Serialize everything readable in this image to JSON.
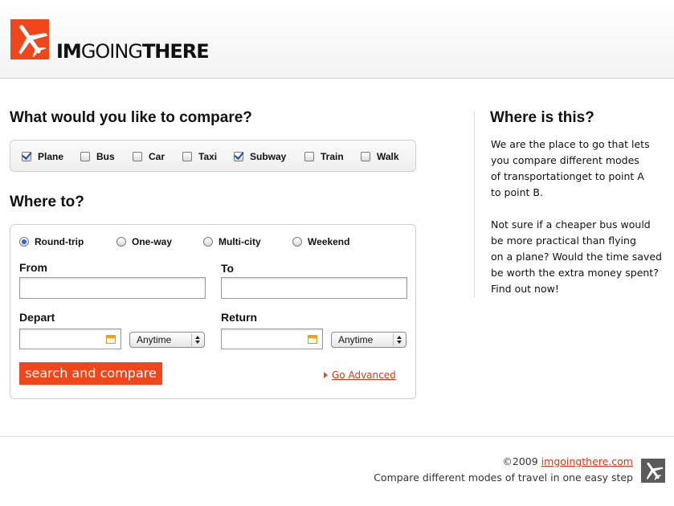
{
  "brand": {
    "logo_bold_1": "IM",
    "logo_light": "GOING",
    "logo_bold_2": "THERE",
    "logo_icon": "airplane-icon",
    "accent_color": "#f0461b"
  },
  "compare": {
    "heading": "What would you like to compare?",
    "modes": [
      {
        "label": "Plane",
        "checked": true
      },
      {
        "label": "Bus",
        "checked": false
      },
      {
        "label": "Car",
        "checked": false
      },
      {
        "label": "Taxi",
        "checked": false
      },
      {
        "label": "Subway",
        "checked": true
      },
      {
        "label": "Train",
        "checked": false
      },
      {
        "label": "Walk",
        "checked": false
      }
    ]
  },
  "search": {
    "heading": "Where to?",
    "trip_types": [
      {
        "label": "Round-trip",
        "selected": true
      },
      {
        "label": "One-way",
        "selected": false
      },
      {
        "label": "Multi-city",
        "selected": false
      },
      {
        "label": "Weekend",
        "selected": false
      }
    ],
    "from_label": "From",
    "from_value": "",
    "to_label": "To",
    "to_value": "",
    "depart_label": "Depart",
    "depart_date": "",
    "depart_time": "Anytime",
    "return_label": "Return",
    "return_date": "",
    "return_time": "Anytime",
    "submit_label": "search and compare",
    "advanced_link": "Go Advanced"
  },
  "about": {
    "heading": "Where is this?",
    "paragraph_1": [
      "We are the place to go that lets",
      "you compare different modes",
      "of transportationget to point A",
      "to point B."
    ],
    "paragraph_2": [
      "Not sure if a cheaper bus would",
      "be more practical than flying",
      "on a plane? Would the time saved",
      "be worth the extra money spent?",
      "Find out now!"
    ]
  },
  "footer": {
    "copyright": "©2009",
    "site_link": "imgoingthere.com",
    "tagline": "Compare different modes of travel in one easy step",
    "icon": "airplane-icon"
  }
}
